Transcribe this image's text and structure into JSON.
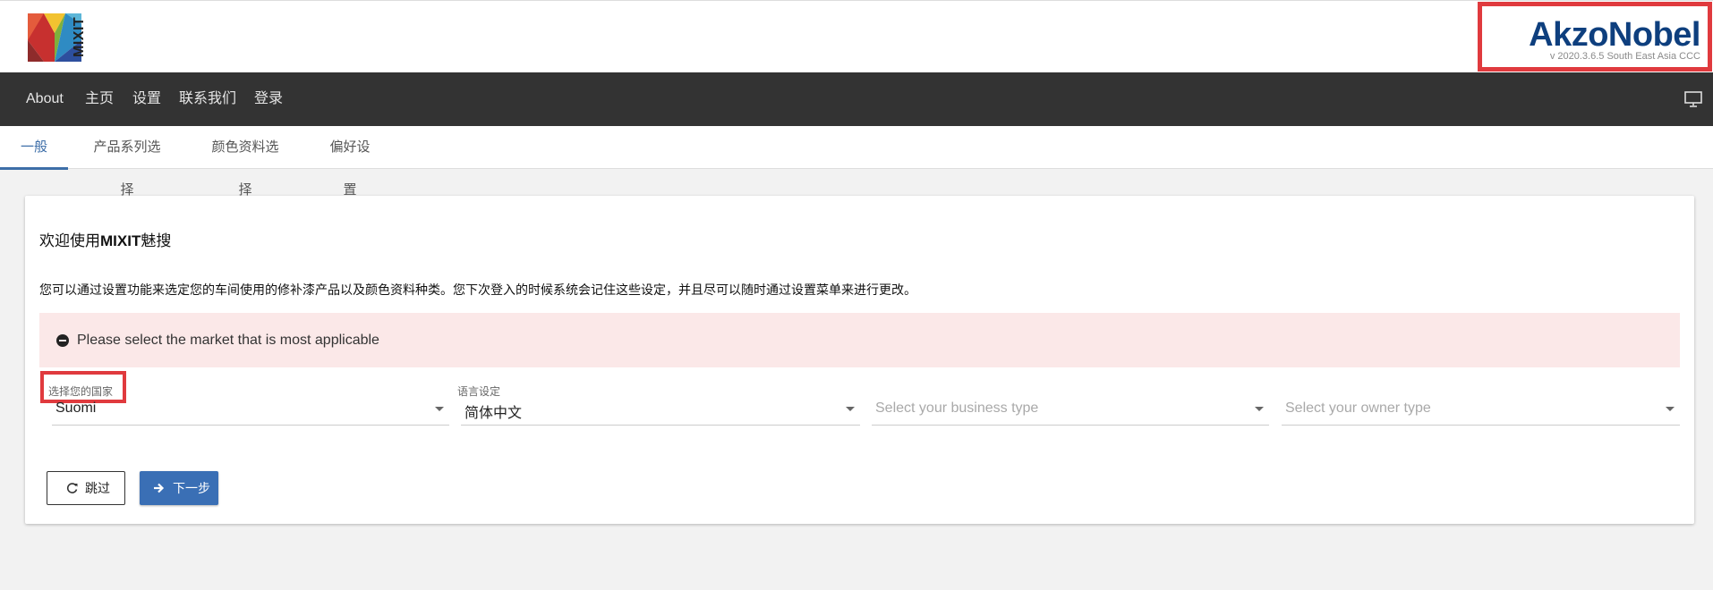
{
  "header": {
    "logo_text": "MIXIT",
    "brand_name": "AkzoNobel",
    "brand_version": "v 2020.3.6.5 South East Asia CCC"
  },
  "nav": {
    "items": [
      "About",
      "主页",
      "设置",
      "联系我们",
      "登录"
    ]
  },
  "tabs": [
    {
      "label": "一般",
      "active": true
    },
    {
      "label": "产品系列选择",
      "active": false
    },
    {
      "label": "颜色资料选择",
      "active": false
    },
    {
      "label": "偏好设置",
      "active": false
    }
  ],
  "main": {
    "welcome_prefix": "欢迎使用",
    "welcome_bold": "MIXIT",
    "welcome_suffix": "魅搜",
    "intro": "您可以通过设置功能来选定您的车间使用的修补漆产品以及颜色资料种类。您下次登入的时候系统会记住这些设定，并且尽可以随时通过设置菜单来进行更改。",
    "alert_text": "Please select the market that is most applicable",
    "fields": {
      "country_label": "选择您的国家",
      "country_value": "Suomi",
      "language_label": "语言设定",
      "language_value": "简体中文",
      "business_placeholder": "Select your business type",
      "owner_placeholder": "Select your owner type"
    },
    "buttons": {
      "skip": "跳过",
      "next": "下一步"
    }
  },
  "colors": {
    "nav_bg": "#333333",
    "accent": "#3d6ea8",
    "brand_blue": "#0e3f7e",
    "highlight_red": "#e03a3e",
    "alert_bg": "#fbe8e8",
    "primary_button": "#3a6fb5"
  }
}
